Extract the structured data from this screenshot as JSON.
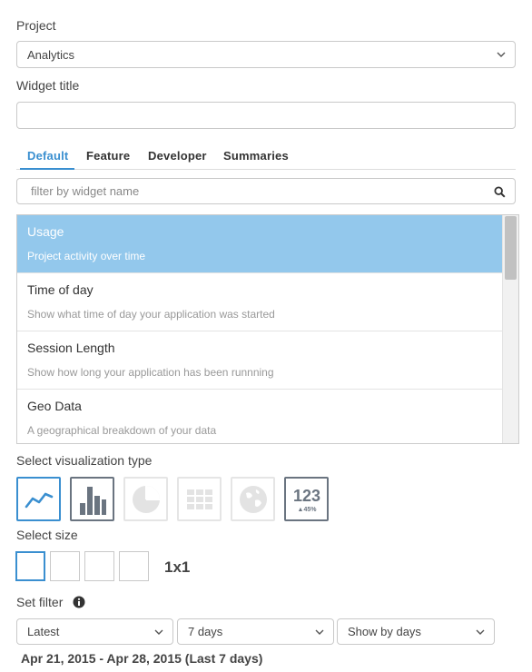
{
  "project": {
    "label": "Project",
    "selected": "Analytics"
  },
  "widget_title": {
    "label": "Widget title",
    "value": ""
  },
  "tabs": [
    {
      "label": "Default",
      "active": true
    },
    {
      "label": "Feature",
      "active": false
    },
    {
      "label": "Developer",
      "active": false
    },
    {
      "label": "Summaries",
      "active": false
    }
  ],
  "search": {
    "placeholder": "filter by widget name",
    "icon": "search-icon"
  },
  "widgets": [
    {
      "title": "Usage",
      "description": "Project activity over time",
      "selected": true
    },
    {
      "title": "Time of day",
      "description": "Show what time of day your application was started",
      "selected": false
    },
    {
      "title": "Session Length",
      "description": "Show how long your application has been runnning",
      "selected": false
    },
    {
      "title": "Geo Data",
      "description": "A geographical breakdown of your data",
      "selected": false
    }
  ],
  "visualization": {
    "label": "Select visualization type",
    "types": [
      {
        "name": "line-chart-icon",
        "state": "active"
      },
      {
        "name": "bar-chart-icon",
        "state": "enabled"
      },
      {
        "name": "pie-chart-icon",
        "state": "disabled"
      },
      {
        "name": "grid-icon",
        "state": "disabled"
      },
      {
        "name": "globe-icon",
        "state": "disabled"
      },
      {
        "name": "number-icon",
        "state": "enabled",
        "number": "123",
        "delta": "▲45%"
      }
    ]
  },
  "size": {
    "label": "Select size",
    "selected_label": "1x1"
  },
  "filter": {
    "label": "Set filter",
    "icon": "info-icon",
    "period": "Latest",
    "range": "7 days",
    "grouping": "Show by days",
    "date_range": "Apr 21, 2015 - Apr 28, 2015 (Last 7 days)"
  },
  "colors": {
    "accent": "#3a8fd0",
    "selected_row": "#93c8ec"
  }
}
